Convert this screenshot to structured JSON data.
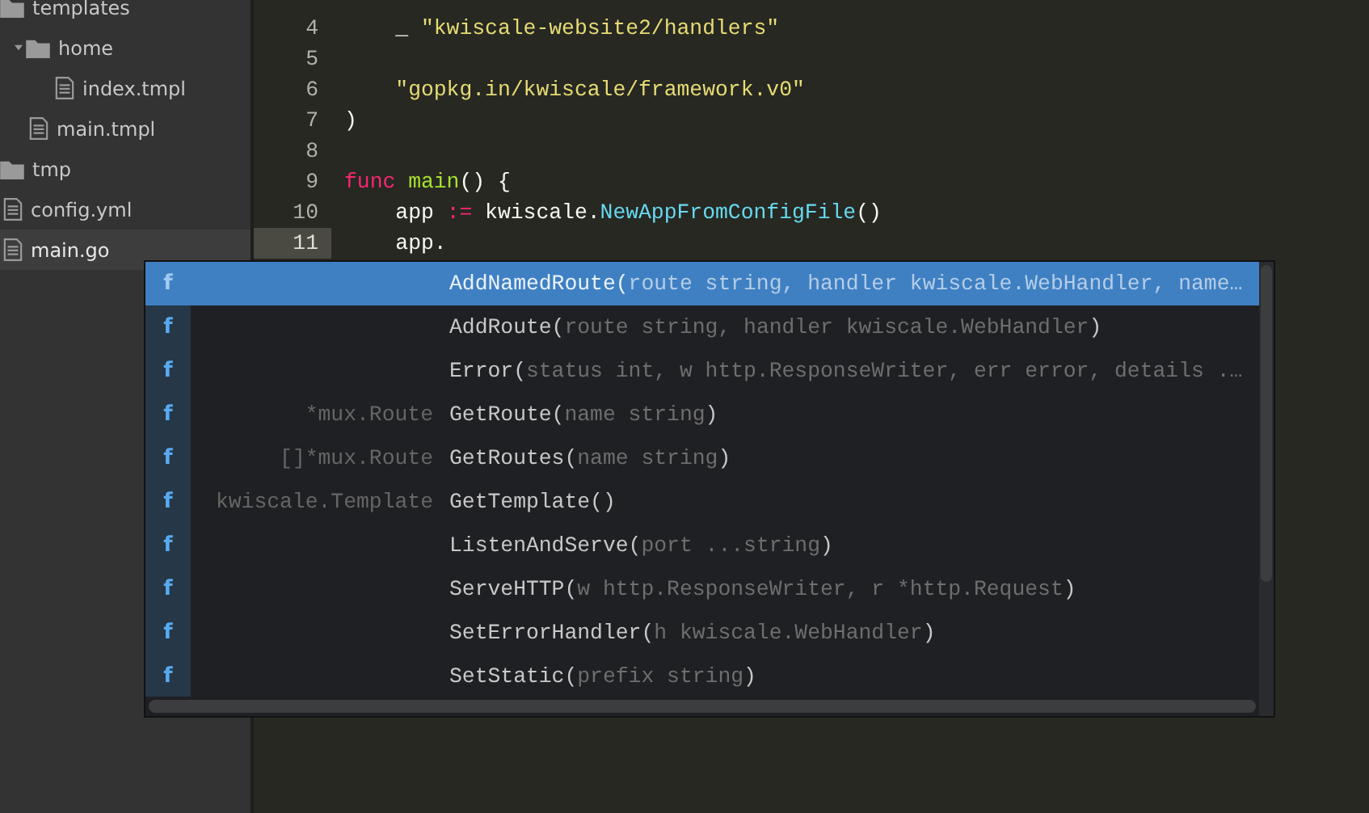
{
  "sidebar": {
    "items": [
      {
        "name": "templates",
        "kind": "folder",
        "selected": false,
        "children": [
          {
            "name": "home",
            "kind": "folder",
            "expanded": true,
            "selected": false,
            "children": [
              {
                "name": "index.tmpl",
                "kind": "file",
                "selected": false
              }
            ]
          },
          {
            "name": "main.tmpl",
            "kind": "file",
            "selected": false
          }
        ]
      },
      {
        "name": "tmp",
        "kind": "folder",
        "selected": false
      },
      {
        "name": "config.yml",
        "kind": "file",
        "selected": false
      },
      {
        "name": "main.go",
        "kind": "file",
        "selected": true
      }
    ]
  },
  "editor": {
    "lines": [
      {
        "number": "4",
        "current": false,
        "tokens": [
          {
            "kind": "plain",
            "text": "    _ "
          },
          {
            "kind": "string",
            "text": "\"kwiscale-website2/handlers\""
          }
        ]
      },
      {
        "number": "5",
        "current": false
      },
      {
        "number": "6",
        "current": false,
        "tokens": [
          {
            "kind": "string",
            "text": "    \"gopkg.in/kwiscale/framework.v0\""
          }
        ]
      },
      {
        "number": "7",
        "current": false,
        "tokens": [
          {
            "kind": "plain",
            "text": ")"
          }
        ]
      },
      {
        "number": "8",
        "current": false
      },
      {
        "number": "9",
        "current": false,
        "tokens": [
          {
            "kind": "keyword",
            "text": "func"
          },
          {
            "kind": "function",
            "text": " main"
          },
          {
            "kind": "plain",
            "text": "() {"
          }
        ]
      },
      {
        "number": "10",
        "current": false,
        "tokens": [
          {
            "kind": "plain",
            "text": "    app "
          },
          {
            "kind": "keyword",
            "text": ":="
          },
          {
            "kind": "plain",
            "text": " kwiscale."
          },
          {
            "kind": "call",
            "text": "NewAppFromConfigFile"
          },
          {
            "kind": "plain",
            "text": "()"
          }
        ]
      },
      {
        "number": "11",
        "current": true,
        "tokens": [
          {
            "kind": "plain",
            "text": "    app."
          }
        ]
      }
    ]
  },
  "autocomplete": {
    "items": [
      {
        "icon": "f",
        "name": "AddNamedRoute(",
        "params": "route string, handler kwiscale.WebHandler, name…",
        "selected": true
      },
      {
        "icon": "f",
        "name": "AddRoute(",
        "params": "route string, handler kwiscale.WebHandler",
        "close": ")",
        "selected": false
      },
      {
        "icon": "f",
        "name": "Error(",
        "params": "status int, w http.ResponseWriter, err error, details .…",
        "selected": false
      },
      {
        "icon": "f",
        "type": "*mux.Route",
        "name": "GetRoute(",
        "params": "name string",
        "close": ")",
        "selected": false
      },
      {
        "icon": "f",
        "type": "[]*mux.Route",
        "name": "GetRoutes(",
        "params": "name string",
        "close": ")",
        "selected": false
      },
      {
        "icon": "f",
        "type": "kwiscale.Template",
        "name": "GetTemplate()",
        "selected": false
      },
      {
        "icon": "f",
        "name": "ListenAndServe(",
        "params": "port ...string",
        "close": ")",
        "selected": false
      },
      {
        "icon": "f",
        "name": "ServeHTTP(",
        "params": "w http.ResponseWriter, r *http.Request",
        "close": ")",
        "selected": false
      },
      {
        "icon": "f",
        "name": "SetErrorHandler(",
        "params": "h kwiscale.WebHandler",
        "close": ")",
        "selected": false
      },
      {
        "icon": "f",
        "name": "SetStatic(",
        "params": "prefix string",
        "close": ")",
        "selected": false
      }
    ]
  }
}
